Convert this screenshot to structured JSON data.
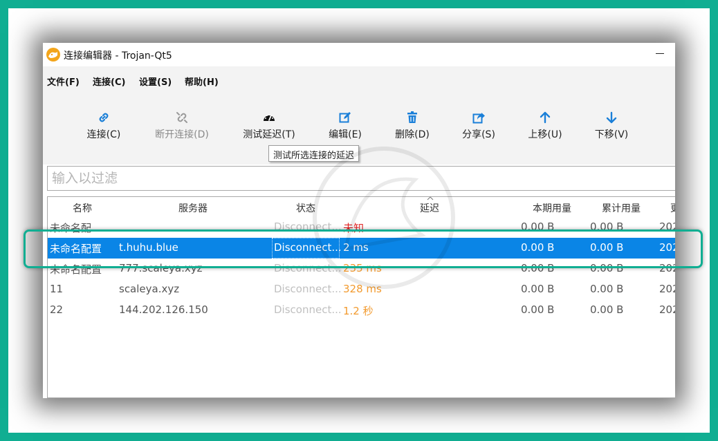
{
  "window": {
    "title": "连接编辑器 - Trojan-Qt5"
  },
  "menu": [
    "文件(F)",
    "连接(C)",
    "设置(S)",
    "帮助(H)"
  ],
  "toolbar": [
    {
      "label": "连接(C)",
      "icon": "link-icon",
      "enabled": true
    },
    {
      "label": "断开连接(D)",
      "icon": "unlink-icon",
      "enabled": false
    },
    {
      "label": "测试延迟(T)",
      "icon": "speedometer-icon",
      "enabled": true
    },
    {
      "label": "编辑(E)",
      "icon": "edit-icon",
      "enabled": true
    },
    {
      "label": "删除(D)",
      "icon": "trash-icon",
      "enabled": true
    },
    {
      "label": "分享(S)",
      "icon": "share-icon",
      "enabled": true
    },
    {
      "label": "上移(U)",
      "icon": "arrow-up-icon",
      "enabled": true
    },
    {
      "label": "下移(V)",
      "icon": "arrow-down-icon",
      "enabled": true
    }
  ],
  "tooltip": "测试所选连接的延迟",
  "filter": {
    "placeholder": "输入以过滤",
    "value": ""
  },
  "table": {
    "headers": [
      "名称",
      "服务器",
      "状态",
      "延迟",
      "本期用量",
      "累计用量",
      "更"
    ],
    "rows": [
      {
        "name": "未命名配",
        "server": "",
        "status": "Disconnect...",
        "latency": "未知",
        "latency_color": "red",
        "period": "0.00 B",
        "total": "0.00 B",
        "date": "202"
      },
      {
        "name": "未命名配置",
        "server": "t.huhu.blue",
        "status": "Disconnect...",
        "latency": "2 ms",
        "latency_color": "white",
        "period": "0.00 B",
        "total": "0.00 B",
        "date": "202",
        "selected": true
      },
      {
        "name": "未命名配置",
        "server": "777.scaleya.xyz",
        "status": "Disconnect...",
        "latency": "235 ms",
        "latency_color": "orange",
        "period": "0.00 B",
        "total": "0.00 B",
        "date": "202"
      },
      {
        "name": "11",
        "server": "scaleya.xyz",
        "status": "Disconnect...",
        "latency": "328 ms",
        "latency_color": "orange",
        "period": "0.00 B",
        "total": "0.00 B",
        "date": "202"
      },
      {
        "name": "22",
        "server": "144.202.126.150",
        "status": "Disconnect...",
        "latency": "1.2 秒",
        "latency_color": "orange",
        "period": "0.00 B",
        "total": "0.00 B",
        "date": "202"
      }
    ]
  },
  "colors": {
    "border": "#10ae92",
    "selection": "#0a85e6",
    "toolbar_icon": "#1a7fd8",
    "latency_red": "#e02020",
    "latency_orange": "#f29a2e"
  }
}
